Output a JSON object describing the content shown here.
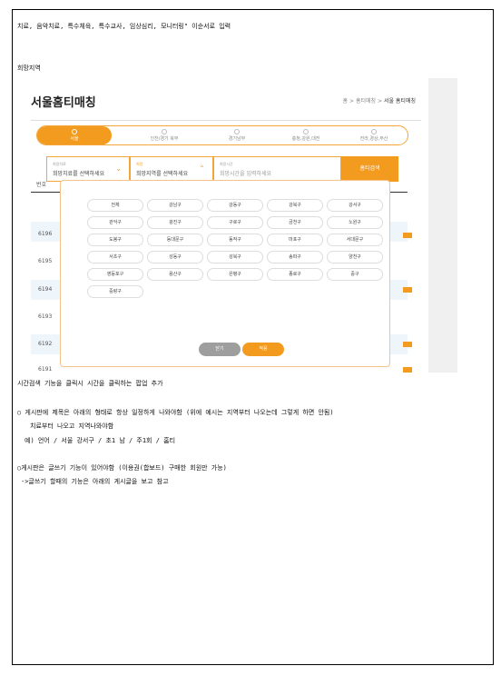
{
  "doc": {
    "line_top": "치료, 음악치료, 특수체육, 특수교사, 임상심리, 모니터링\" 이순서로 입력",
    "label_region": "희망지역",
    "line_caption": "시간검색 기능을 클릭시 시간을 클릭하는 팝업 추가",
    "line_board1": "○ 게시판에 제목은 아래의 형태로 항상 일정하게 나와야함 (위에 예시는 지역부터 나오는데 그렇게 하면 안됨)",
    "line_board2": "치료부터 나오고 지역나와야함",
    "line_example": "예) 언어 / 서울 강서구 / 초1 남 / 주1회 / 홈티",
    "line_write1": "○게시판은 글쓰기 기능이 있어야함 (이용권(합보드) 구매한 회원만 가능)",
    "line_write2": "->글쓰기 할때의 기능은 아래의 게시글을 보고 참고"
  },
  "screenshot": {
    "title": "서울홈티매칭",
    "breadcrumb": {
      "home": "홈",
      "sep1": ">",
      "mid": "홈티매칭",
      "sep2": ">",
      "current": "서울 홈티매칭"
    },
    "tabs": [
      {
        "label": "서울",
        "active": true
      },
      {
        "label": "인천/경기 북부",
        "active": false
      },
      {
        "label": "경기남부",
        "active": false
      },
      {
        "label": "충청,강원,대전",
        "active": false
      },
      {
        "label": "전라,경상,부산",
        "active": false
      }
    ],
    "filter": {
      "therapy_small": "희망치료",
      "therapy_text": "희망치료를 선택하세요",
      "region_small": "희망",
      "region_text": "희망지역를 선택하세요",
      "time_small": "희망시간",
      "time_text": "희망시간을 입력하세요",
      "search_button": "홈티검색"
    },
    "table_header": "번호",
    "rows": [
      "6196",
      "6195",
      "6194",
      "6193",
      "6192",
      "6191"
    ],
    "popup": {
      "districts": [
        "전체",
        "강남구",
        "강동구",
        "강북구",
        "강서구",
        "관악구",
        "광진구",
        "구로구",
        "금천구",
        "노원구",
        "도봉구",
        "동대문구",
        "동작구",
        "마포구",
        "서대문구",
        "서초구",
        "성동구",
        "성북구",
        "송파구",
        "양천구",
        "영등포구",
        "용산구",
        "은평구",
        "종로구",
        "중구",
        "중랑구"
      ],
      "close_label": "닫기",
      "apply_label": "적용"
    },
    "colors": {
      "accent": "#f39b1f",
      "close_btn": "#9e9e9e"
    }
  }
}
